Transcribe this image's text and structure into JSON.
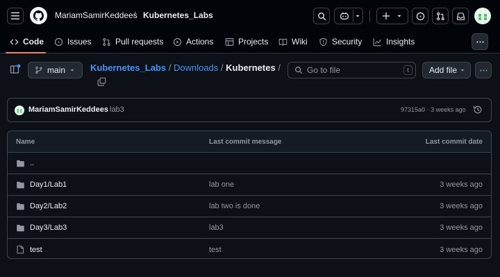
{
  "header": {
    "owner": "MariamSamirKeddees",
    "separator": "/",
    "repo": "Kubernetes_Labs"
  },
  "tabs": [
    {
      "label": "Code",
      "icon": "code-icon"
    },
    {
      "label": "Issues",
      "icon": "issue-icon"
    },
    {
      "label": "Pull requests",
      "icon": "pull-request-icon"
    },
    {
      "label": "Actions",
      "icon": "play-icon"
    },
    {
      "label": "Projects",
      "icon": "table-icon"
    },
    {
      "label": "Wiki",
      "icon": "book-icon"
    },
    {
      "label": "Security",
      "icon": "shield-icon"
    },
    {
      "label": "Insights",
      "icon": "graph-icon"
    }
  ],
  "toolbar": {
    "branch": "main",
    "breadcrumb": [
      "Kubernetes_Labs",
      "Downloads",
      "Kubernetes"
    ],
    "breadcrumb_sep": "/",
    "search_placeholder": "Go to file",
    "search_shortcut": "t",
    "add_file": "Add file"
  },
  "commit": {
    "author": "MariamSamirKeddees",
    "message": "lab3",
    "sha": "97315a0",
    "dot": "·",
    "time": "3 weeks ago"
  },
  "table": {
    "columns": [
      "Name",
      "Last commit message",
      "Last commit date"
    ],
    "parent": "..",
    "rows": [
      {
        "name": "Day1/Lab1",
        "type": "folder",
        "message": "lab one",
        "date": "3 weeks ago"
      },
      {
        "name": "Day2/Lab2",
        "type": "folder",
        "message": "lab two is done",
        "date": "3 weeks ago"
      },
      {
        "name": "Day3/Lab3",
        "type": "folder",
        "message": "lab3",
        "date": "3 weeks ago"
      },
      {
        "name": "test",
        "type": "file",
        "message": "test",
        "date": "3 weeks ago"
      }
    ]
  },
  "colors": {
    "accent_underline": "#f78166",
    "link": "#4493f8",
    "background": "#0d1117"
  }
}
